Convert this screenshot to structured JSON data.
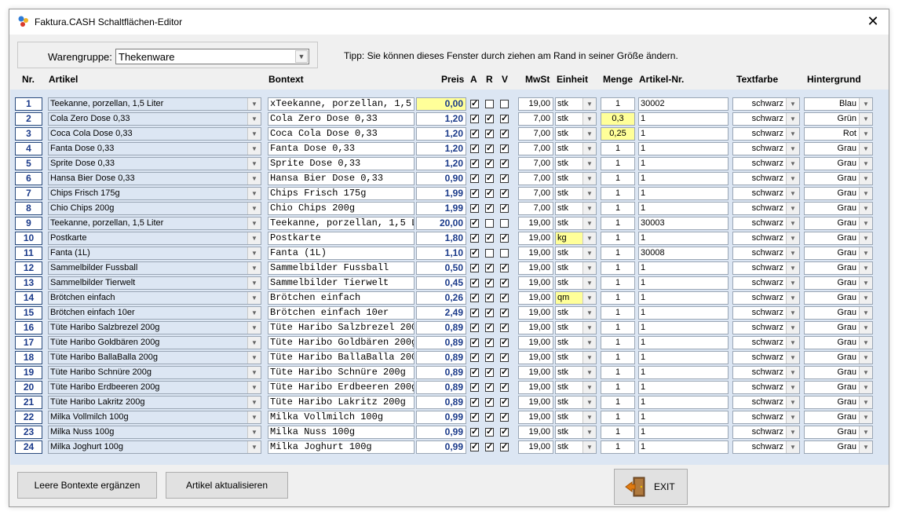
{
  "window": {
    "title": "Faktura.CASH Schaltflächen-Editor"
  },
  "warengruppe": {
    "label": "Warengruppe:",
    "value": "Thekenware"
  },
  "tip": "Tipp: Sie können dieses Fenster durch ziehen am Rand in seiner Größe ändern.",
  "headers": {
    "nr": "Nr.",
    "artikel": "Artikel",
    "bontext": "Bontext",
    "preis": "Preis",
    "a": "A",
    "r": "R",
    "v": "V",
    "mwst": "MwSt",
    "einheit": "Einheit",
    "menge": "Menge",
    "artikelnr": "Artikel-Nr.",
    "textfarbe": "Textfarbe",
    "hintergrund": "Hintergrund"
  },
  "rows": [
    {
      "nr": "1",
      "artikel": "Teekanne, porzellan, 1,5 Liter",
      "bontext": "xTeekanne, porzellan, 1,5",
      "preis": "0,00",
      "a": true,
      "r": false,
      "v": false,
      "mwst": "19,00",
      "einheit": "stk",
      "menge": "1",
      "artikelnr": "30002",
      "textfarbe": "schwarz",
      "hintergrund": "Blau"
    },
    {
      "nr": "2",
      "artikel": "Cola Zero Dose 0,33",
      "bontext": "Cola Zero Dose 0,33",
      "preis": "1,20",
      "a": true,
      "r": true,
      "v": true,
      "mwst": "7,00",
      "einheit": "stk",
      "menge": "0,3",
      "artikelnr": "1",
      "textfarbe": "schwarz",
      "hintergrund": "Grün"
    },
    {
      "nr": "3",
      "artikel": "Coca Cola Dose 0,33",
      "bontext": "Coca Cola Dose 0,33",
      "preis": "1,20",
      "a": true,
      "r": true,
      "v": true,
      "mwst": "7,00",
      "einheit": "stk",
      "menge": "0,25",
      "artikelnr": "1",
      "textfarbe": "schwarz",
      "hintergrund": "Rot"
    },
    {
      "nr": "4",
      "artikel": "Fanta Dose 0,33",
      "bontext": "Fanta Dose 0,33",
      "preis": "1,20",
      "a": true,
      "r": true,
      "v": true,
      "mwst": "7,00",
      "einheit": "stk",
      "menge": "1",
      "artikelnr": "1",
      "textfarbe": "schwarz",
      "hintergrund": "Grau"
    },
    {
      "nr": "5",
      "artikel": "Sprite Dose 0,33",
      "bontext": "Sprite Dose 0,33",
      "preis": "1,20",
      "a": true,
      "r": true,
      "v": true,
      "mwst": "7,00",
      "einheit": "stk",
      "menge": "1",
      "artikelnr": "1",
      "textfarbe": "schwarz",
      "hintergrund": "Grau"
    },
    {
      "nr": "6",
      "artikel": "Hansa Bier Dose 0,33",
      "bontext": "Hansa Bier Dose 0,33",
      "preis": "0,90",
      "a": true,
      "r": true,
      "v": true,
      "mwst": "7,00",
      "einheit": "stk",
      "menge": "1",
      "artikelnr": "1",
      "textfarbe": "schwarz",
      "hintergrund": "Grau"
    },
    {
      "nr": "7",
      "artikel": "Chips Frisch 175g",
      "bontext": "Chips Frisch 175g",
      "preis": "1,99",
      "a": true,
      "r": true,
      "v": true,
      "mwst": "7,00",
      "einheit": "stk",
      "menge": "1",
      "artikelnr": "1",
      "textfarbe": "schwarz",
      "hintergrund": "Grau"
    },
    {
      "nr": "8",
      "artikel": "Chio Chips 200g",
      "bontext": "Chio Chips 200g",
      "preis": "1,99",
      "a": true,
      "r": true,
      "v": true,
      "mwst": "7,00",
      "einheit": "stk",
      "menge": "1",
      "artikelnr": "1",
      "textfarbe": "schwarz",
      "hintergrund": "Grau"
    },
    {
      "nr": "9",
      "artikel": "Teekanne, porzellan, 1,5 Liter",
      "bontext": "Teekanne, porzellan, 1,5 L",
      "preis": "20,00",
      "a": true,
      "r": false,
      "v": false,
      "mwst": "19,00",
      "einheit": "stk",
      "menge": "1",
      "artikelnr": "30003",
      "textfarbe": "schwarz",
      "hintergrund": "Grau"
    },
    {
      "nr": "10",
      "artikel": "Postkarte",
      "bontext": "Postkarte",
      "preis": "1,80",
      "a": true,
      "r": true,
      "v": true,
      "mwst": "19,00",
      "einheit": "kg",
      "menge": "1",
      "artikelnr": "1",
      "textfarbe": "schwarz",
      "hintergrund": "Grau"
    },
    {
      "nr": "11",
      "artikel": "Fanta (1L)",
      "bontext": "Fanta (1L)",
      "preis": "1,10",
      "a": true,
      "r": false,
      "v": false,
      "mwst": "19,00",
      "einheit": "stk",
      "menge": "1",
      "artikelnr": "30008",
      "textfarbe": "schwarz",
      "hintergrund": "Grau"
    },
    {
      "nr": "12",
      "artikel": "Sammelbilder Fussball",
      "bontext": "Sammelbilder Fussball",
      "preis": "0,50",
      "a": true,
      "r": true,
      "v": true,
      "mwst": "19,00",
      "einheit": "stk",
      "menge": "1",
      "artikelnr": "1",
      "textfarbe": "schwarz",
      "hintergrund": "Grau"
    },
    {
      "nr": "13",
      "artikel": "Sammelbilder Tierwelt",
      "bontext": "Sammelbilder Tierwelt",
      "preis": "0,45",
      "a": true,
      "r": true,
      "v": true,
      "mwst": "19,00",
      "einheit": "stk",
      "menge": "1",
      "artikelnr": "1",
      "textfarbe": "schwarz",
      "hintergrund": "Grau"
    },
    {
      "nr": "14",
      "artikel": "Brötchen einfach",
      "bontext": "Brötchen einfach",
      "preis": "0,26",
      "a": true,
      "r": true,
      "v": true,
      "mwst": "19,00",
      "einheit": "qm",
      "menge": "1",
      "artikelnr": "1",
      "textfarbe": "schwarz",
      "hintergrund": "Grau"
    },
    {
      "nr": "15",
      "artikel": "Brötchen einfach 10er",
      "bontext": "Brötchen einfach 10er",
      "preis": "2,49",
      "a": true,
      "r": true,
      "v": true,
      "mwst": "19,00",
      "einheit": "stk",
      "menge": "1",
      "artikelnr": "1",
      "textfarbe": "schwarz",
      "hintergrund": "Grau"
    },
    {
      "nr": "16",
      "artikel": "Tüte Haribo Salzbrezel 200g",
      "bontext": "Tüte Haribo Salzbrezel 200",
      "preis": "0,89",
      "a": true,
      "r": true,
      "v": true,
      "mwst": "19,00",
      "einheit": "stk",
      "menge": "1",
      "artikelnr": "1",
      "textfarbe": "schwarz",
      "hintergrund": "Grau"
    },
    {
      "nr": "17",
      "artikel": "Tüte Haribo Goldbären 200g",
      "bontext": "Tüte Haribo Goldbären 200g",
      "preis": "0,89",
      "a": true,
      "r": true,
      "v": true,
      "mwst": "19,00",
      "einheit": "stk",
      "menge": "1",
      "artikelnr": "1",
      "textfarbe": "schwarz",
      "hintergrund": "Grau"
    },
    {
      "nr": "18",
      "artikel": "Tüte Haribo BallaBalla 200g",
      "bontext": "Tüte Haribo BallaBalla 200",
      "preis": "0,89",
      "a": true,
      "r": true,
      "v": true,
      "mwst": "19,00",
      "einheit": "stk",
      "menge": "1",
      "artikelnr": "1",
      "textfarbe": "schwarz",
      "hintergrund": "Grau"
    },
    {
      "nr": "19",
      "artikel": "Tüte Haribo Schnüre 200g",
      "bontext": "Tüte Haribo Schnüre 200g",
      "preis": "0,89",
      "a": true,
      "r": true,
      "v": true,
      "mwst": "19,00",
      "einheit": "stk",
      "menge": "1",
      "artikelnr": "1",
      "textfarbe": "schwarz",
      "hintergrund": "Grau"
    },
    {
      "nr": "20",
      "artikel": "Tüte Haribo Erdbeeren 200g",
      "bontext": "Tüte Haribo Erdbeeren 200g",
      "preis": "0,89",
      "a": true,
      "r": true,
      "v": true,
      "mwst": "19,00",
      "einheit": "stk",
      "menge": "1",
      "artikelnr": "1",
      "textfarbe": "schwarz",
      "hintergrund": "Grau"
    },
    {
      "nr": "21",
      "artikel": "Tüte Haribo Lakritz 200g",
      "bontext": "Tüte Haribo Lakritz 200g",
      "preis": "0,89",
      "a": true,
      "r": true,
      "v": true,
      "mwst": "19,00",
      "einheit": "stk",
      "menge": "1",
      "artikelnr": "1",
      "textfarbe": "schwarz",
      "hintergrund": "Grau"
    },
    {
      "nr": "22",
      "artikel": "Milka Vollmilch 100g",
      "bontext": "Milka Vollmilch 100g",
      "preis": "0,99",
      "a": true,
      "r": true,
      "v": true,
      "mwst": "19,00",
      "einheit": "stk",
      "menge": "1",
      "artikelnr": "1",
      "textfarbe": "schwarz",
      "hintergrund": "Grau"
    },
    {
      "nr": "23",
      "artikel": "Milka Nuss 100g",
      "bontext": "Milka Nuss 100g",
      "preis": "0,99",
      "a": true,
      "r": true,
      "v": true,
      "mwst": "19,00",
      "einheit": "stk",
      "menge": "1",
      "artikelnr": "1",
      "textfarbe": "schwarz",
      "hintergrund": "Grau"
    },
    {
      "nr": "24",
      "artikel": "Milka Joghurt 100g",
      "bontext": "Milka Joghurt 100g",
      "preis": "0,99",
      "a": true,
      "r": true,
      "v": true,
      "mwst": "19,00",
      "einheit": "stk",
      "menge": "1",
      "artikelnr": "1",
      "textfarbe": "schwarz",
      "hintergrund": "Grau"
    }
  ],
  "highlights": {
    "preis_yellow_rows": [
      0
    ],
    "menge_yellow_rows": [
      1,
      2
    ],
    "einheit_yellow_rows": [
      9,
      13
    ]
  },
  "buttons": {
    "leere": "Leere Bontexte ergänzen",
    "aktualisieren": "Artikel aktualisieren",
    "exit": "EXIT"
  },
  "colors": {
    "grid_bg": "#dce6f3",
    "nr_text": "#1a3a8a",
    "highlight": "#ffff99"
  }
}
